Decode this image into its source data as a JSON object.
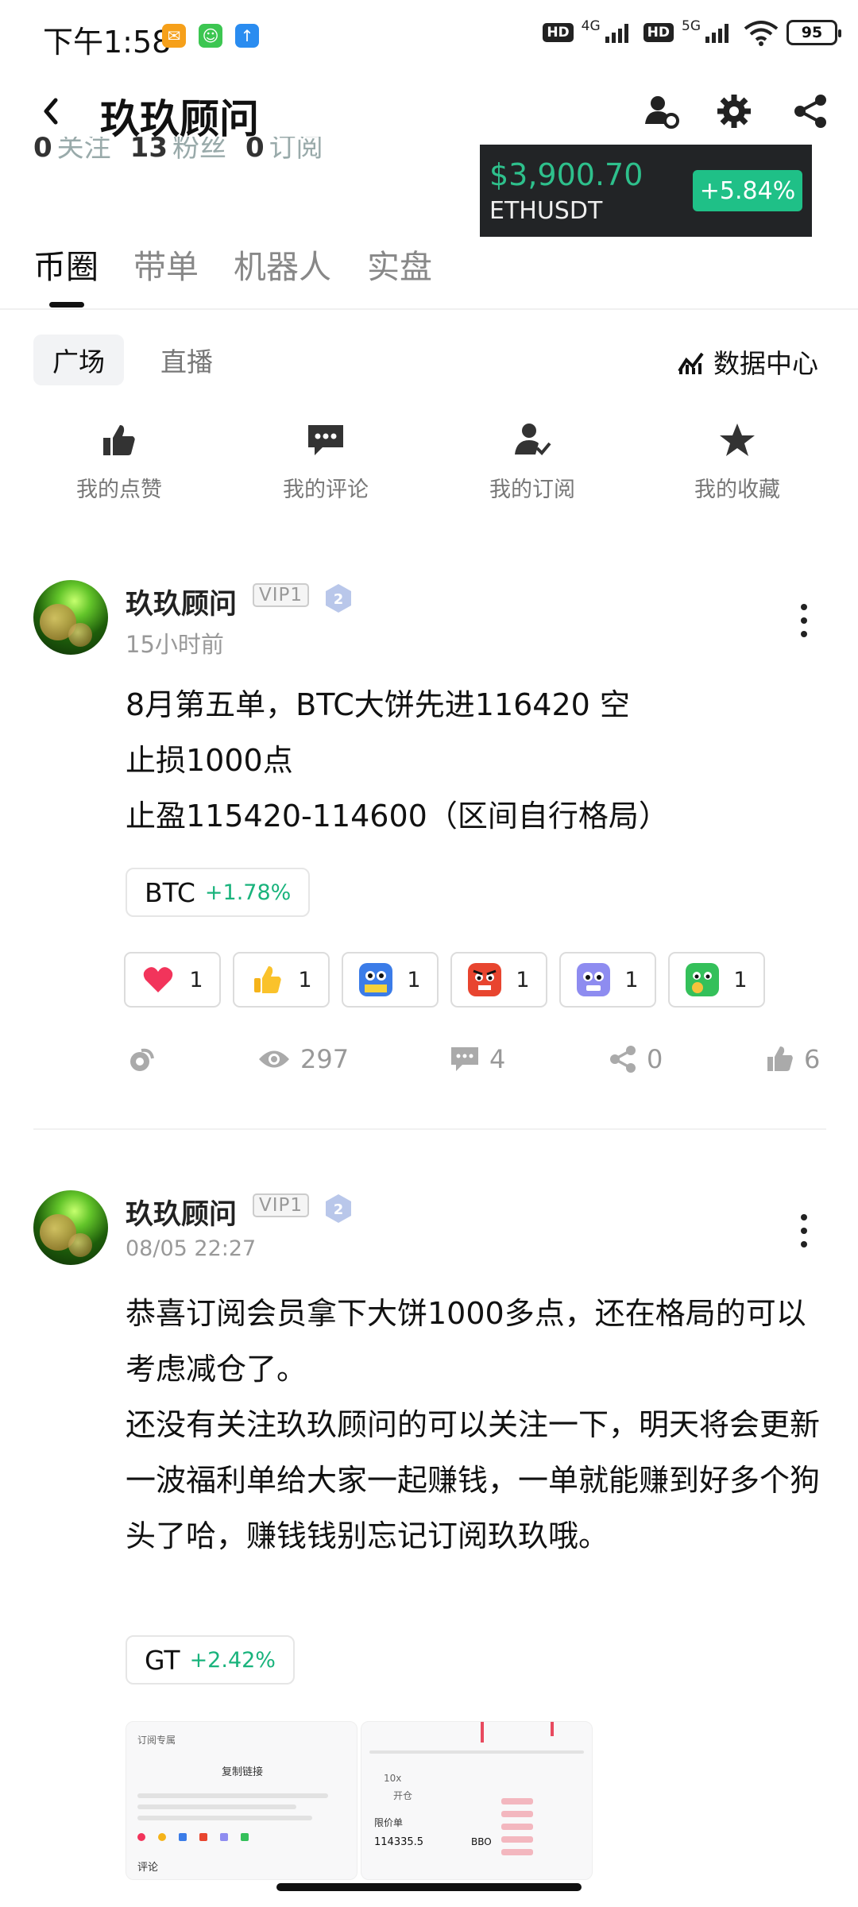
{
  "status_bar": {
    "time": "下午1:58",
    "network_1": "4G",
    "network_2": "5G",
    "hd": "HD",
    "battery": "95"
  },
  "header": {
    "title": "玖玖顾问"
  },
  "profile_stats": {
    "following_count": "0",
    "following_label": "关注",
    "fans_count": "13",
    "fans_label": "粉丝",
    "subs_count": "0",
    "subs_label": "订阅"
  },
  "ticker": {
    "price": "$3,900.70",
    "pair": "ETHUSDT",
    "change": "+5.84%",
    "up_color": "#1fc087"
  },
  "main_tabs": [
    "币圈",
    "带单",
    "机器人",
    "实盘"
  ],
  "sub_tabs": [
    "广场",
    "直播"
  ],
  "data_center_label": "数据中心",
  "shortcuts": [
    {
      "label": "我的点赞",
      "icon": "thumbs-up-icon"
    },
    {
      "label": "我的评论",
      "icon": "comment-icon"
    },
    {
      "label": "我的订阅",
      "icon": "user-check-icon"
    },
    {
      "label": "我的收藏",
      "icon": "star-icon"
    }
  ],
  "posts": [
    {
      "author": "玖玖顾问",
      "vip": "VIP1",
      "level": "2",
      "time": "15小时前",
      "text": "8月第五单，BTC大饼先进116420 空\n止损1000点\n止盈115420-114600（区间自行格局）",
      "tag": {
        "symbol": "BTC",
        "change": "+1.78%"
      },
      "reactions": [
        {
          "icon": "heart-icon",
          "count": "1"
        },
        {
          "icon": "thumbs-up-emoji-icon",
          "count": "1"
        },
        {
          "icon": "hodl-emoji-icon",
          "count": "1"
        },
        {
          "icon": "angry-emoji-icon",
          "count": "1"
        },
        {
          "icon": "worried-emoji-icon",
          "count": "1"
        },
        {
          "icon": "green-emoji-icon",
          "count": "1"
        }
      ],
      "stats": {
        "views": "297",
        "comments": "4",
        "shares": "0",
        "likes": "6"
      }
    },
    {
      "author": "玖玖顾问",
      "vip": "VIP1",
      "level": "2",
      "time": "08/05 22:27",
      "text": "恭喜订阅会员拿下大饼1000多点，还在格局的可以考虑减仓了。\n还没有关注玖玖顾问的可以关注一下，明天将会更新一波福利单给大家一起赚钱，一单就能赚到好多个狗头了哈，赚钱钱别忘记订阅玖玖哦。",
      "tag": {
        "symbol": "GT",
        "change": "+2.42%"
      },
      "images": [
        {
          "caption_1": "订阅专属",
          "caption_2": "复制链接",
          "caption_3": "评论"
        },
        {
          "row_1": "开仓",
          "row_2": "限价单",
          "row_3": "114335.5",
          "row_4": "BBO",
          "row_5": "10x"
        }
      ]
    }
  ]
}
